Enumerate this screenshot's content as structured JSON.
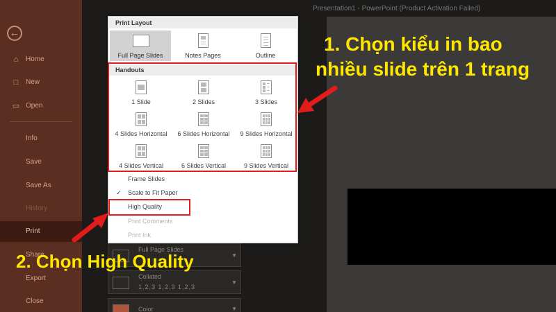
{
  "window": {
    "title": "Presentation1  -  PowerPoint (Product Activation Failed)"
  },
  "sidebar": {
    "items": [
      {
        "label": "Home",
        "icon": "home-icon"
      },
      {
        "label": "New",
        "icon": "new-document-icon"
      },
      {
        "label": "Open",
        "icon": "folder-open-icon"
      },
      {
        "label": "Info"
      },
      {
        "label": "Save"
      },
      {
        "label": "Save As"
      },
      {
        "label": "History"
      },
      {
        "label": "Print"
      },
      {
        "label": "Share"
      },
      {
        "label": "Export"
      },
      {
        "label": "Close"
      }
    ]
  },
  "dropdown": {
    "layout_header": "Print Layout",
    "layouts": [
      {
        "label": "Full Page Slides",
        "selected": true
      },
      {
        "label": "Notes Pages"
      },
      {
        "label": "Outline"
      }
    ],
    "handouts_header": "Handouts",
    "handouts": [
      {
        "label": "1 Slide"
      },
      {
        "label": "2 Slides"
      },
      {
        "label": "3 Slides"
      },
      {
        "label": "4 Slides Horizontal"
      },
      {
        "label": "6 Slides Horizontal"
      },
      {
        "label": "9 Slides Horizontal"
      },
      {
        "label": "4 Slides Vertical"
      },
      {
        "label": "6 Slides Vertical"
      },
      {
        "label": "9 Slides Vertical"
      }
    ],
    "options": [
      {
        "label": "Frame Slides",
        "checked": false,
        "disabled": false
      },
      {
        "label": "Scale to Fit Paper",
        "checked": true,
        "disabled": false
      },
      {
        "label": "High Quality",
        "checked": false,
        "disabled": false
      },
      {
        "label": "Print Comments",
        "checked": false,
        "disabled": true
      },
      {
        "label": "Print Ink",
        "checked": false,
        "disabled": true
      }
    ]
  },
  "settings": {
    "layout": {
      "label": "Full Page Slides"
    },
    "collate": {
      "label": "Collated",
      "sub": "1,2,3    1,2,3    1,2,3"
    },
    "color": {
      "label": "Color"
    }
  },
  "annotations": {
    "callout1_line1": "1. Chọn kiểu in bao",
    "callout1_line2": "nhiều slide trên 1 trang",
    "callout2": "2. Chọn High Quality"
  },
  "colors": {
    "sidebar_bg": "#5a2f22",
    "sidebar_active": "#3b1b12",
    "annotation_red": "#e21b1b",
    "annotation_yellow": "#ffe600"
  }
}
